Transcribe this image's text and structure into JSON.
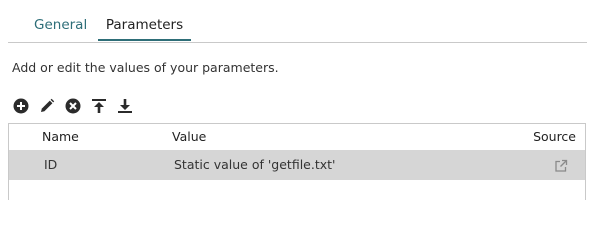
{
  "tabs": [
    {
      "label": "General",
      "active": false
    },
    {
      "label": "Parameters",
      "active": true
    }
  ],
  "description": "Add or edit the values of your parameters.",
  "toolbar": {
    "icons": [
      "add-circle-icon",
      "edit-pencil-icon",
      "remove-circle-icon",
      "move-to-top-icon",
      "move-to-bottom-icon"
    ]
  },
  "table": {
    "columns": {
      "name": "Name",
      "value": "Value",
      "source": "Source"
    },
    "rows": [
      {
        "name": "ID",
        "value": "Static value of 'getfile.txt'",
        "source_icon": "external-link-icon",
        "selected": true
      }
    ]
  },
  "colors": {
    "accent": "#2e6e78",
    "selected_row": "#d6d6d6",
    "border": "#c9c9c9"
  }
}
